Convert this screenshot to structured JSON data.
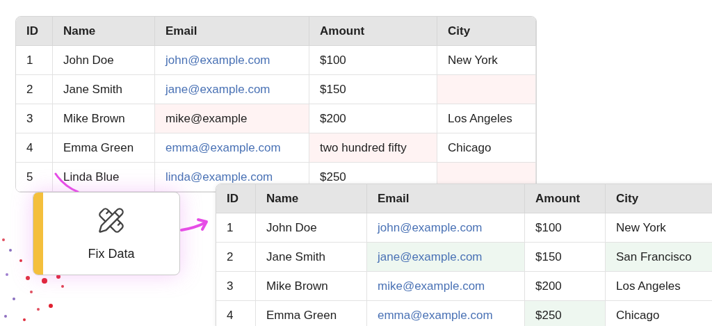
{
  "tables": [
    {
      "columns": [
        "ID",
        "Name",
        "Email",
        "Amount",
        "City"
      ],
      "rows": [
        {
          "cells": [
            {
              "text": "1",
              "link": false,
              "invalid": false,
              "corrected": false
            },
            {
              "text": "John Doe",
              "link": false,
              "invalid": false,
              "corrected": false
            },
            {
              "text": "john@example.com",
              "link": true,
              "invalid": false,
              "corrected": false
            },
            {
              "text": "$100",
              "link": false,
              "invalid": false,
              "corrected": false
            },
            {
              "text": "New York",
              "link": false,
              "invalid": false,
              "corrected": false
            }
          ]
        },
        {
          "cells": [
            {
              "text": "2",
              "link": false,
              "invalid": false,
              "corrected": false
            },
            {
              "text": "Jane Smith",
              "link": false,
              "invalid": false,
              "corrected": false
            },
            {
              "text": "jane@example.com",
              "link": true,
              "invalid": false,
              "corrected": false
            },
            {
              "text": "$150",
              "link": false,
              "invalid": false,
              "corrected": false
            },
            {
              "invalid": true,
              "corrected": false
            }
          ]
        },
        {
          "cells": [
            {
              "text": "3",
              "link": false,
              "invalid": false,
              "corrected": false
            },
            {
              "text": "Mike Brown",
              "link": false,
              "invalid": false,
              "corrected": false
            },
            {
              "text": "mike@example",
              "link": false,
              "invalid": true,
              "corrected": false
            },
            {
              "text": "$200",
              "link": false,
              "invalid": false,
              "corrected": false
            },
            {
              "text": "Los Angeles",
              "link": false,
              "invalid": false,
              "corrected": false
            }
          ]
        },
        {
          "cells": [
            {
              "text": "4",
              "link": false,
              "invalid": false,
              "corrected": false
            },
            {
              "text": "Emma Green",
              "link": false,
              "invalid": false,
              "corrected": false
            },
            {
              "text": "emma@example.com",
              "link": true,
              "invalid": false,
              "corrected": false
            },
            {
              "text": "two hundred fifty",
              "link": false,
              "invalid": true,
              "corrected": false
            },
            {
              "text": "Chicago",
              "link": false,
              "invalid": false,
              "corrected": false
            }
          ]
        },
        {
          "cells": [
            {
              "text": "5",
              "link": false,
              "invalid": false,
              "corrected": false
            },
            {
              "text": "Linda Blue",
              "link": false,
              "invalid": false,
              "corrected": false
            },
            {
              "text": "linda@example.com",
              "link": true,
              "invalid": false,
              "corrected": false
            },
            {
              "text": "$250",
              "link": false,
              "invalid": false,
              "corrected": false
            },
            {
              "invalid": true,
              "corrected": false
            }
          ]
        }
      ]
    },
    {
      "columns": [
        "ID",
        "Name",
        "Email",
        "Amount",
        "City"
      ],
      "rows": [
        {
          "cells": [
            {
              "text": "1",
              "link": false,
              "invalid": false,
              "corrected": false
            },
            {
              "text": "John Doe",
              "link": false,
              "invalid": false,
              "corrected": false
            },
            {
              "text": "john@example.com",
              "link": true,
              "invalid": false,
              "corrected": false
            },
            {
              "text": "$100",
              "link": false,
              "invalid": false,
              "corrected": false
            },
            {
              "text": "New York",
              "link": false,
              "invalid": false,
              "corrected": false
            }
          ]
        },
        {
          "cells": [
            {
              "text": "2",
              "link": false,
              "invalid": false,
              "corrected": false
            },
            {
              "text": "Jane Smith",
              "link": false,
              "invalid": false,
              "corrected": false
            },
            {
              "text": "jane@example.com",
              "link": true,
              "invalid": false,
              "corrected": true
            },
            {
              "text": "$150",
              "link": false,
              "invalid": false,
              "corrected": false
            },
            {
              "text": "San Francisco",
              "link": false,
              "invalid": false,
              "corrected": true
            }
          ]
        },
        {
          "cells": [
            {
              "text": "3",
              "link": false,
              "invalid": false,
              "corrected": false
            },
            {
              "text": "Mike Brown",
              "link": false,
              "invalid": false,
              "corrected": false
            },
            {
              "text": "mike@example.com",
              "link": true,
              "invalid": false,
              "corrected": false
            },
            {
              "text": "$200",
              "link": false,
              "invalid": false,
              "corrected": false
            },
            {
              "text": "Los Angeles",
              "link": false,
              "invalid": false,
              "corrected": false
            }
          ]
        },
        {
          "cells": [
            {
              "text": "4",
              "link": false,
              "invalid": false,
              "corrected": false
            },
            {
              "text": "Emma Green",
              "link": false,
              "invalid": false,
              "corrected": false
            },
            {
              "text": "emma@example.com",
              "link": true,
              "invalid": false,
              "corrected": false
            },
            {
              "text": "$250",
              "link": false,
              "invalid": false,
              "corrected": true
            },
            {
              "text": "Chicago",
              "link": false,
              "invalid": false,
              "corrected": false
            }
          ]
        }
      ]
    }
  ],
  "action": {
    "label": "Fix Data"
  }
}
